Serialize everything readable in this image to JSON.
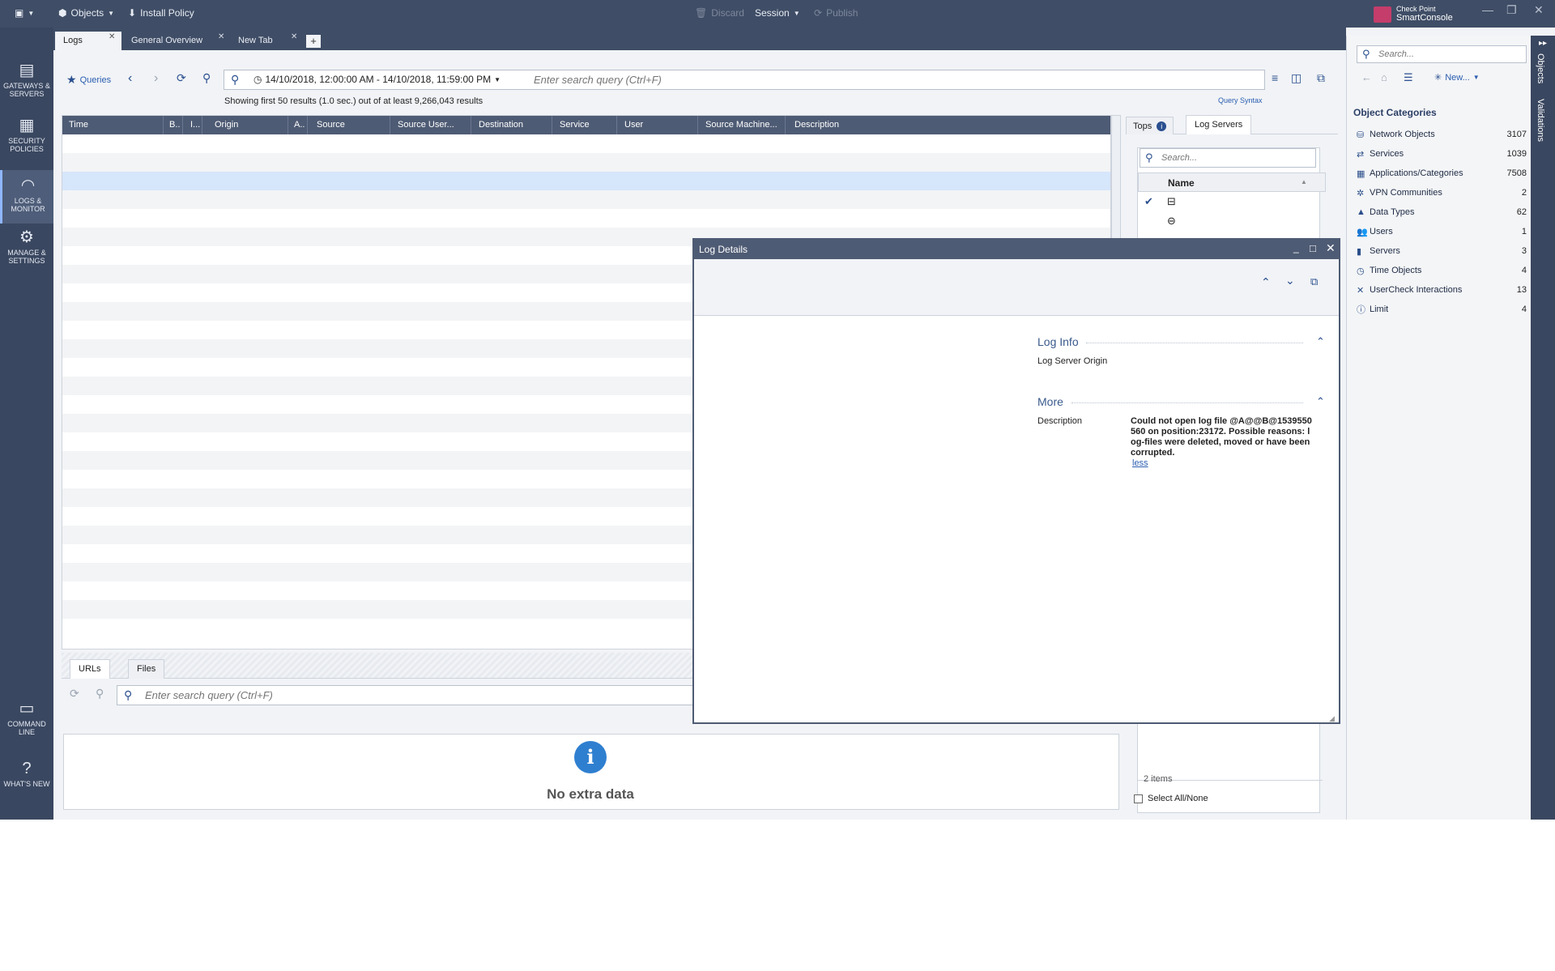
{
  "topbar": {
    "objects_label": "Objects",
    "install_policy_label": "Install Policy",
    "discard_label": "Discard",
    "session_label": "Session",
    "publish_label": "Publish",
    "brand_line1": "Check Point",
    "brand_line2": "SmartConsole"
  },
  "leftnav": {
    "items": [
      {
        "label": "GATEWAYS & SERVERS",
        "icon": "gateways-icon"
      },
      {
        "label": "SECURITY POLICIES",
        "icon": "policies-icon"
      },
      {
        "label": "LOGS & MONITOR",
        "icon": "logs-monitor-icon"
      },
      {
        "label": "MANAGE & SETTINGS",
        "icon": "gear-icon"
      },
      {
        "label": "COMMAND LINE",
        "icon": "command-line-icon"
      },
      {
        "label": "WHAT'S NEW",
        "icon": "question-icon"
      }
    ]
  },
  "tabs": [
    {
      "label": "Logs"
    },
    {
      "label": "General Overview"
    },
    {
      "label": "New Tab"
    }
  ],
  "toolbar": {
    "queries_label": "Queries",
    "time_range": "14/10/2018, 12:00:00 AM - 14/10/2018, 11:59:00 PM",
    "search_placeholder": "Enter search query (Ctrl+F)",
    "results_text": "Showing first 50 results (1.0 sec.) out of at least 9,266,043 results",
    "query_syntax_label": "Query Syntax"
  },
  "grid": {
    "columns": [
      "Time",
      "B..",
      "I...",
      "Origin",
      "A..",
      "Source",
      "Source User...",
      "Destination",
      "Service",
      "User",
      "Source Machine...",
      "Description"
    ]
  },
  "bottom": {
    "tabs": [
      "URLs",
      "Files"
    ],
    "search_placeholder": "Enter search query (Ctrl+F)",
    "empty_text": "No extra data"
  },
  "side": {
    "tabs": [
      "Tops",
      "Log Servers"
    ],
    "search_placeholder": "Search...",
    "name_header": "Name",
    "items_count": "2 items",
    "select_all_label": "Select All/None"
  },
  "logdetails": {
    "title": "Log Details",
    "log_info_title": "Log Info",
    "log_server_origin_label": "Log Server Origin",
    "more_title": "More",
    "description_label": "Description",
    "description_value": "Could not open log file @A@@B@1539550560 on position:23172. Possible reasons: log-files were deleted, moved or have been corrupted.",
    "less_link": "less"
  },
  "objects": {
    "search_placeholder": "Search...",
    "new_label": "New...",
    "categories_title": "Object Categories",
    "categories": [
      {
        "name": "Network Objects",
        "count": "3107"
      },
      {
        "name": "Services",
        "count": "1039"
      },
      {
        "name": "Applications/Categories",
        "count": "7508"
      },
      {
        "name": "VPN Communities",
        "count": "2"
      },
      {
        "name": "Data Types",
        "count": "62"
      },
      {
        "name": "Users",
        "count": "1"
      },
      {
        "name": "Servers",
        "count": "3"
      },
      {
        "name": "Time Objects",
        "count": "4"
      },
      {
        "name": "UserCheck Interactions",
        "count": "13"
      },
      {
        "name": "Limit",
        "count": "4"
      }
    ],
    "vertical_tabs": [
      "Objects",
      "Validations"
    ]
  },
  "colors": {
    "header_bg": "#3f4d66",
    "grid_header": "#4e5b74",
    "selected_row": "#d6e6fb",
    "accent": "#2a5db0"
  }
}
